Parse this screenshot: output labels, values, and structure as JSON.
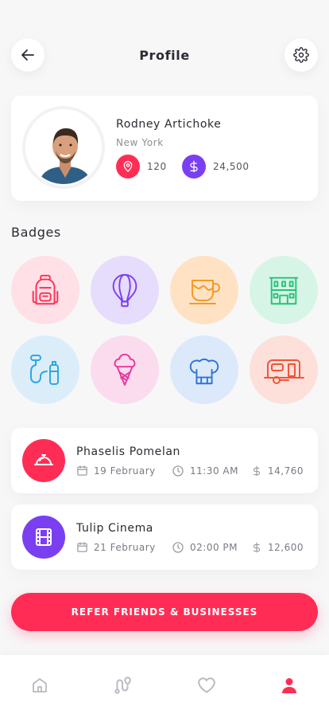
{
  "header": {
    "title": "Profile",
    "back_icon": "arrow-left-icon",
    "settings_icon": "gear-icon"
  },
  "profile": {
    "name": "Rodney Artichoke",
    "city": "New York",
    "stats": [
      {
        "icon": "location-pin-icon",
        "value": "120",
        "color": "#ff2d55"
      },
      {
        "icon": "dollar-icon",
        "value": "24,500",
        "color": "#7b3ff2"
      }
    ]
  },
  "badges": {
    "title": "Badges",
    "items": [
      {
        "icon": "backpack-icon",
        "bg": "#ffe0e6",
        "color": "#ff2d55"
      },
      {
        "icon": "hot-air-balloon-icon",
        "bg": "#e6dcfb",
        "color": "#7b3ff2"
      },
      {
        "icon": "coffee-cup-icon",
        "bg": "#ffe2c4",
        "color": "#f59a24"
      },
      {
        "icon": "building-icon",
        "bg": "#d6f5e6",
        "color": "#25c27a"
      },
      {
        "icon": "water-bottle-icon",
        "bg": "#dcedfa",
        "color": "#2aa8e6"
      },
      {
        "icon": "ice-cream-icon",
        "bg": "#fbdcee",
        "color": "#e8379a"
      },
      {
        "icon": "chef-hat-icon",
        "bg": "#dce9fb",
        "color": "#2f73d9"
      },
      {
        "icon": "caravan-icon",
        "bg": "#fde0da",
        "color": "#f2543a"
      }
    ]
  },
  "events": [
    {
      "title": "Phaselis Pomelan",
      "icon": "cloche-icon",
      "color": "#ff2d55",
      "date": "19 February",
      "time": "11:30 AM",
      "amount": "14,760"
    },
    {
      "title": "Tulip Cinema",
      "icon": "film-icon",
      "color": "#7b3ff2",
      "date": "21 February",
      "time": "02:00 PM",
      "amount": "12,600"
    }
  ],
  "cta": {
    "label": "REFER FRIENDS & BUSINESSES"
  },
  "tabbar": {
    "items": [
      {
        "icon": "home-icon",
        "active": false
      },
      {
        "icon": "route-icon",
        "active": false
      },
      {
        "icon": "heart-icon",
        "active": false
      },
      {
        "icon": "user-icon",
        "active": true
      }
    ],
    "active_color": "#ff2d55",
    "inactive_color": "#b9b9c2"
  }
}
